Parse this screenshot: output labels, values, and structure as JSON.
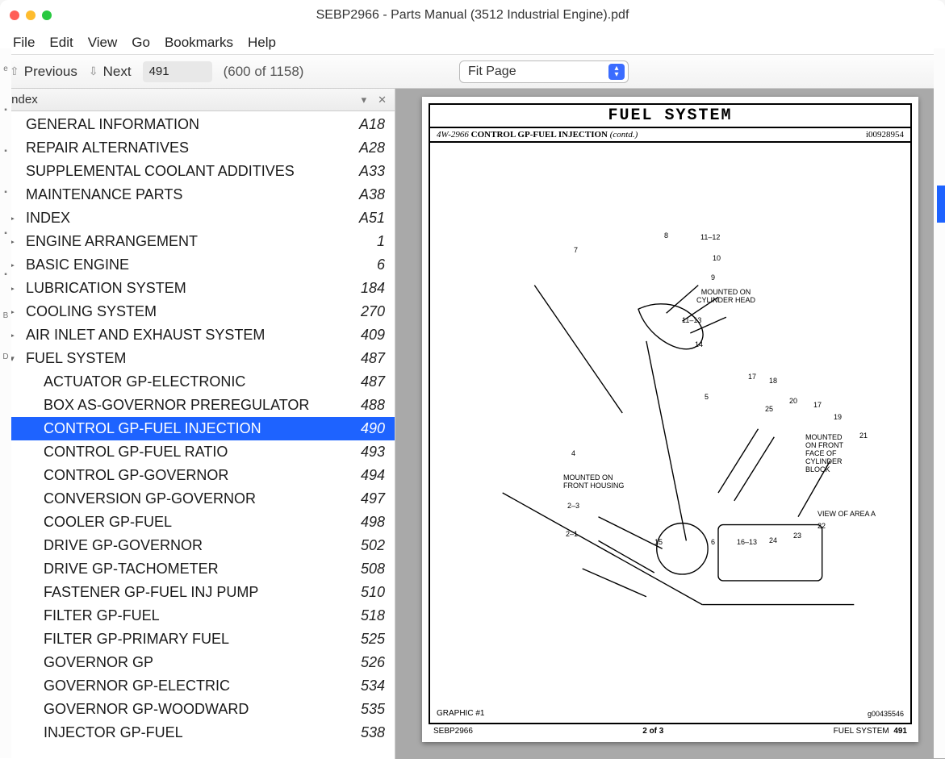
{
  "window": {
    "title": "SEBP2966 - Parts Manual (3512 Industrial Engine).pdf"
  },
  "menu": [
    "File",
    "Edit",
    "View",
    "Go",
    "Bookmarks",
    "Help"
  ],
  "toolbar": {
    "prev": "Previous",
    "next": "Next",
    "page_current": "491",
    "page_total": "(600 of 1158)",
    "zoom": "Fit Page"
  },
  "sidebar": {
    "title": "Index",
    "items": [
      {
        "level": 1,
        "tw": "",
        "label": "GENERAL INFORMATION",
        "pg": "A18"
      },
      {
        "level": 1,
        "tw": "",
        "label": "REPAIR ALTERNATIVES",
        "pg": "A28"
      },
      {
        "level": 1,
        "tw": "",
        "label": "SUPPLEMENTAL COOLANT ADDITIVES",
        "pg": "A33"
      },
      {
        "level": 1,
        "tw": "",
        "label": "MAINTENANCE PARTS",
        "pg": "A38"
      },
      {
        "level": 1,
        "tw": "▸",
        "label": "INDEX",
        "pg": "A51"
      },
      {
        "level": 1,
        "tw": "▸",
        "label": "ENGINE ARRANGEMENT",
        "pg": "1"
      },
      {
        "level": 1,
        "tw": "▸",
        "label": "BASIC ENGINE",
        "pg": "6"
      },
      {
        "level": 1,
        "tw": "▸",
        "label": "LUBRICATION SYSTEM",
        "pg": "184"
      },
      {
        "level": 1,
        "tw": "▸",
        "label": "COOLING SYSTEM",
        "pg": "270"
      },
      {
        "level": 1,
        "tw": "▸",
        "label": "AIR INLET AND EXHAUST SYSTEM",
        "pg": "409"
      },
      {
        "level": 1,
        "tw": "▾",
        "label": "FUEL SYSTEM",
        "pg": "487"
      },
      {
        "level": 2,
        "tw": "",
        "label": "ACTUATOR GP-ELECTRONIC",
        "pg": "487"
      },
      {
        "level": 2,
        "tw": "",
        "label": "BOX AS-GOVERNOR PREREGULATOR",
        "pg": "488"
      },
      {
        "level": 2,
        "tw": "",
        "label": "CONTROL GP-FUEL INJECTION",
        "pg": "490",
        "selected": true
      },
      {
        "level": 2,
        "tw": "",
        "label": "CONTROL GP-FUEL RATIO",
        "pg": "493"
      },
      {
        "level": 2,
        "tw": "",
        "label": "CONTROL GP-GOVERNOR",
        "pg": "494"
      },
      {
        "level": 2,
        "tw": "",
        "label": "CONVERSION GP-GOVERNOR",
        "pg": "497"
      },
      {
        "level": 2,
        "tw": "",
        "label": "COOLER GP-FUEL",
        "pg": "498"
      },
      {
        "level": 2,
        "tw": "",
        "label": "DRIVE GP-GOVERNOR",
        "pg": "502"
      },
      {
        "level": 2,
        "tw": "",
        "label": "DRIVE GP-TACHOMETER",
        "pg": "508"
      },
      {
        "level": 2,
        "tw": "",
        "label": "FASTENER GP-FUEL INJ PUMP",
        "pg": "510"
      },
      {
        "level": 2,
        "tw": "",
        "label": "FILTER GP-FUEL",
        "pg": "518"
      },
      {
        "level": 2,
        "tw": "",
        "label": "FILTER GP-PRIMARY FUEL",
        "pg": "525"
      },
      {
        "level": 2,
        "tw": "",
        "label": "GOVERNOR GP",
        "pg": "526"
      },
      {
        "level": 2,
        "tw": "",
        "label": "GOVERNOR GP-ELECTRIC",
        "pg": "534"
      },
      {
        "level": 2,
        "tw": "",
        "label": "GOVERNOR GP-WOODWARD",
        "pg": "535"
      },
      {
        "level": 2,
        "tw": "",
        "label": "INJECTOR GP-FUEL",
        "pg": "538"
      }
    ]
  },
  "page": {
    "section_title": "FUEL SYSTEM",
    "part_no": "4W-2966",
    "heading": "CONTROL GP-FUEL INJECTION",
    "contd": "(contd.)",
    "doc_id": "i00928954",
    "graphic_label": "GRAPHIC #1",
    "graphic_id": "g00435546",
    "footer_left": "SEBP2966",
    "footer_center": "2 of 3",
    "footer_right_section": "FUEL SYSTEM",
    "footer_right_page": "491",
    "callouts": {
      "n7": "7",
      "n8": "8",
      "n11_12": "11–12",
      "n10": "10",
      "n9": "9",
      "mounted_head": "MOUNTED ON\nCYLINDER HEAD",
      "n11_13": "11–13",
      "n14": "14",
      "n17a": "17",
      "n18": "18",
      "n5": "5",
      "n25": "25",
      "n20": "20",
      "n17b": "17",
      "n19": "19",
      "n21": "21",
      "mounted_block": "MOUNTED\nON FRONT\nFACE OF\nCYLINDER\nBLOCK",
      "n4": "4",
      "mounted_housing": "MOUNTED ON\nFRONT HOUSING",
      "n2_3": "2–3",
      "view_a": "VIEW OF AREA A",
      "n22": "22",
      "n2_1": "2–1",
      "n15": "15",
      "n6": "6",
      "n16_13": "16–13",
      "n24": "24",
      "n23": "23"
    }
  }
}
